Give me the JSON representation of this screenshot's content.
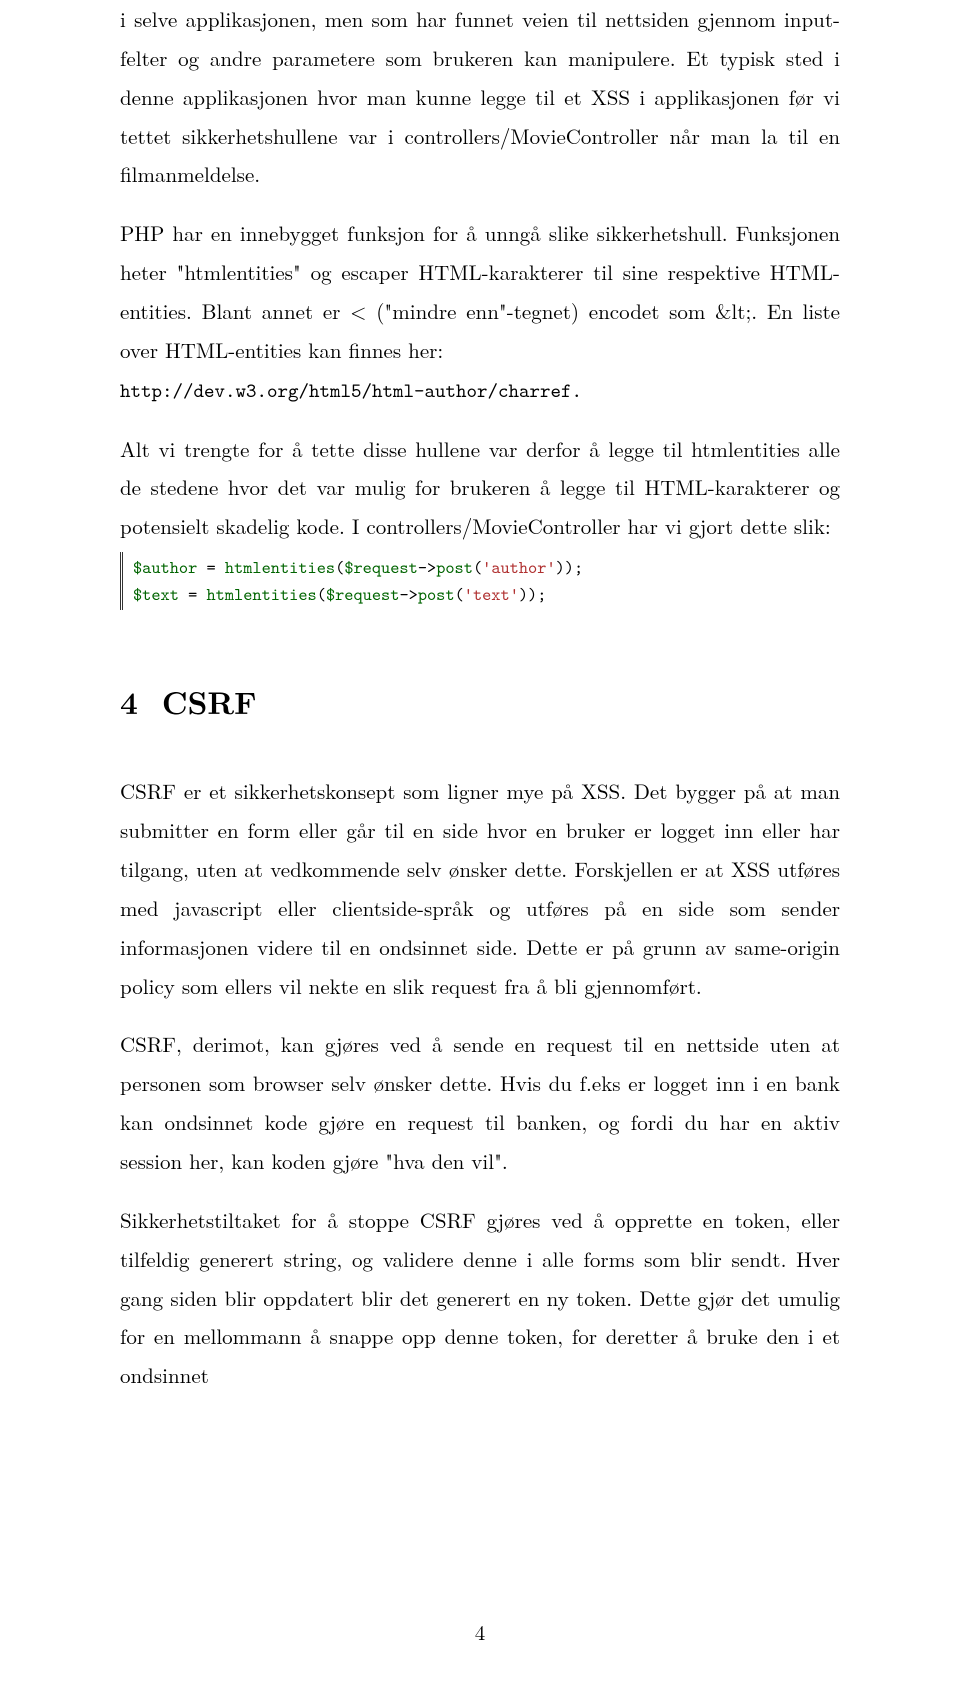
{
  "paragraphs": {
    "p1": "i selve applikasjonen, men som har funnet veien til nettsiden gjennom input-felter og andre parametere som brukeren kan manipulere. Et typisk sted i denne applikasjonen hvor man kunne legge til et XSS i applikasjonen før vi tettet sikkerhetshullene var i controllers/MovieController når man la til en filmanmeldelse.",
    "p2": "PHP har en innebygget funksjon for å unngå slike sikkerhetshull. Funksjonen heter \"htmlentities\" og escaper HTML-karakterer til sine respektive HTML-entities. Blant annet er < (\"mindre enn\"-tegnet) encodet som &lt;. En liste over HTML-entities kan finnes her:",
    "url": "http://dev.w3.org/html5/html-author/charref.",
    "p3": "Alt vi trengte for å tette disse hullene var derfor å legge til htmlentities alle de stedene hvor det var mulig for brukeren å legge til HTML-karakterer og potensielt skadelig kode. I controllers/MovieController har vi gjort dette slik:",
    "code1_tokens": {
      "l1var": "$author",
      "l1fn": "htmlentities",
      "l1req": "$request",
      "l1post": "post",
      "l1str": "author",
      "l2var": "$text",
      "l2fn": "htmlentities",
      "l2req": "$request",
      "l2post": "post",
      "l2str": "text"
    },
    "secnum": "4",
    "sectitle": "CSRF",
    "p4": "CSRF er et sikkerhetskonsept som ligner mye på XSS. Det bygger på at man submitter en form eller går til en side hvor en bruker er logget inn eller har tilgang, uten at vedkommende selv ønsker dette. Forskjellen er at XSS utføres med javascript eller clientside-språk og utføres på en side som sender informasjonen videre til en ondsinnet side. Dette er på grunn av same-origin policy som ellers vil nekte en slik request fra å bli gjennomført.",
    "p5": "CSRF, derimot, kan gjøres ved å sende en request til en nettside uten at personen som browser selv ønsker dette. Hvis du f.eks er logget inn i en bank kan ondsinnet kode gjøre en request til banken, og fordi du har en aktiv session her, kan koden gjøre \"hva den vil\".",
    "p6": "Sikkerhetstiltaket for å stoppe CSRF gjøres ved å opprette en token, eller tilfeldig generert string, og validere denne i alle forms som blir sendt. Hver gang siden blir oppdatert blir det generert en ny token. Dette gjør det umulig for en mellommann å snappe opp denne token, for deretter å bruke den i et ondsinnet"
  },
  "pagenum": "4"
}
